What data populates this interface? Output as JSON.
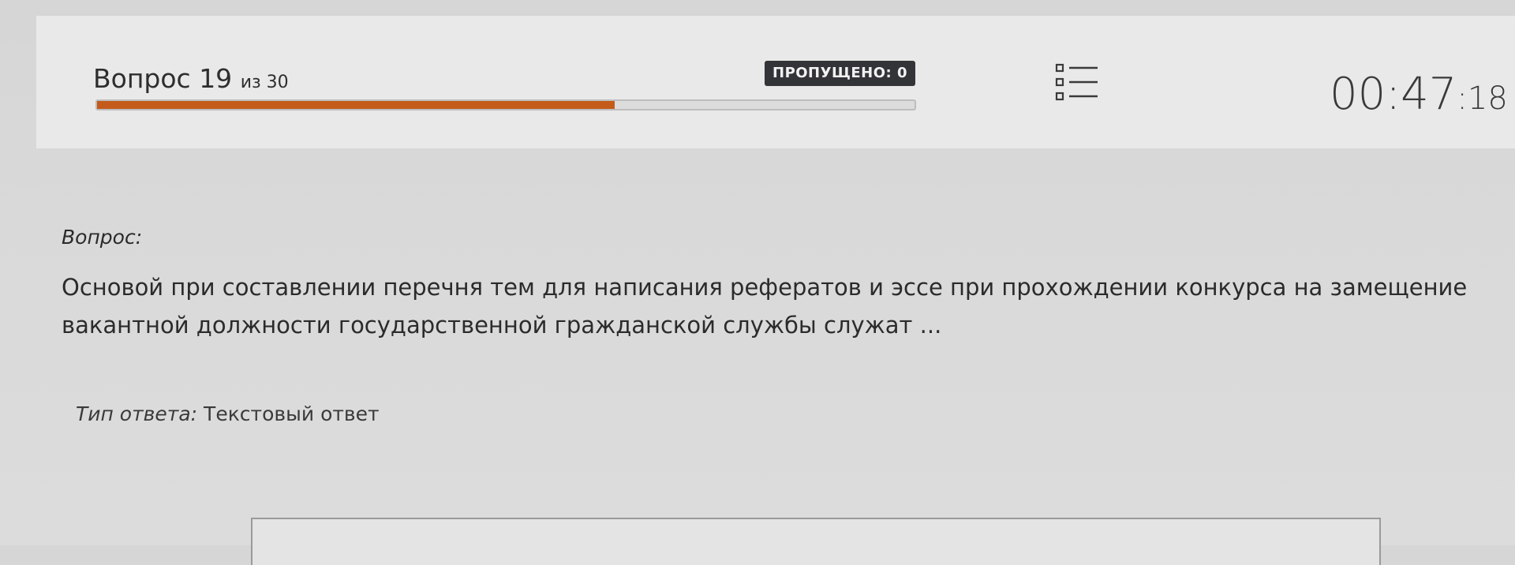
{
  "header": {
    "question_word": "Вопрос",
    "question_current": "19",
    "question_of": "из 30",
    "progress_fraction": 0.633,
    "skipped_label": "ПРОПУЩЕНО: 0",
    "timer_hm": "00:47",
    "timer_ss": ":18",
    "list_icon": "question-list-icon"
  },
  "question": {
    "label": "Вопрос:",
    "text": "Основой при составлении перечня тем для написания рефератов и эссе при прохождении конкурса на замещение вакантной должности государственной гражданской службы служат ..."
  },
  "answer": {
    "type_key": "Тип ответа:",
    "type_value": "Текстовый ответ",
    "value": ""
  },
  "colors": {
    "progress": "#c45b1a",
    "badge": "#333438",
    "header_bg": "#e9e9e9"
  }
}
